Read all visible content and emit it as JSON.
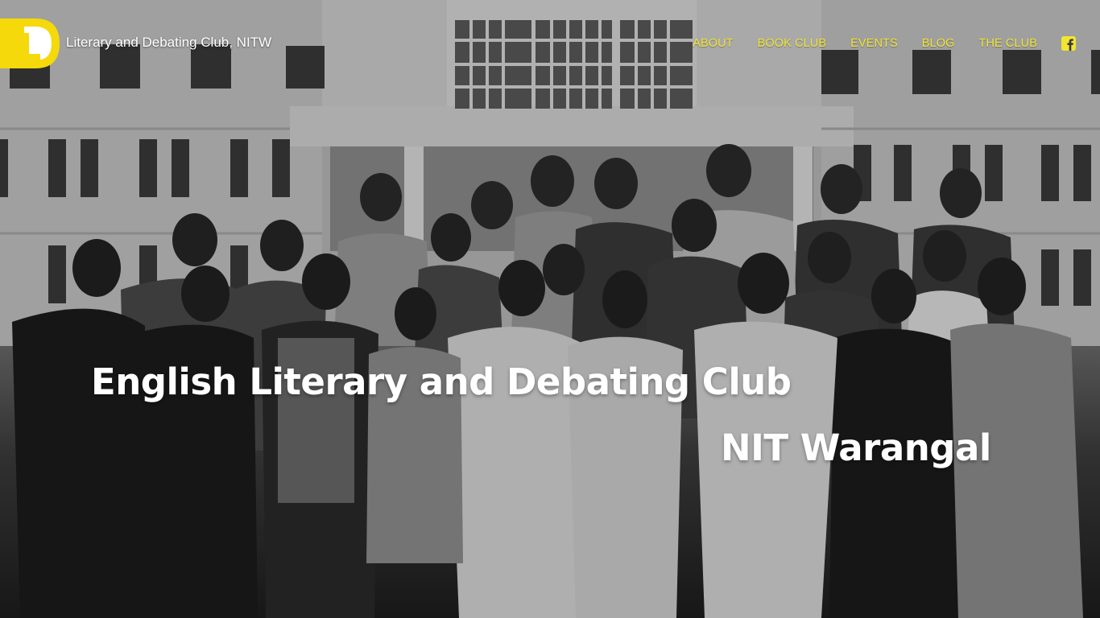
{
  "header": {
    "site_title": "Literary and Debating Club, NITW",
    "logo_icon": "ld-monogram-logo"
  },
  "nav": {
    "items": [
      {
        "label": "ABOUT"
      },
      {
        "label": "BOOK CLUB"
      },
      {
        "label": "EVENTS"
      },
      {
        "label": "BLOG"
      },
      {
        "label": "THE CLUB"
      }
    ],
    "social_icon": "facebook-icon"
  },
  "hero": {
    "title_line_1": "English Literary and Debating Club",
    "title_line_2": "NIT Warangal",
    "background": "black-and-white group photo in front of campus building"
  },
  "colors": {
    "accent_yellow": "#f2e631",
    "logo_yellow": "#f5d90a",
    "text_white": "#ffffff"
  }
}
